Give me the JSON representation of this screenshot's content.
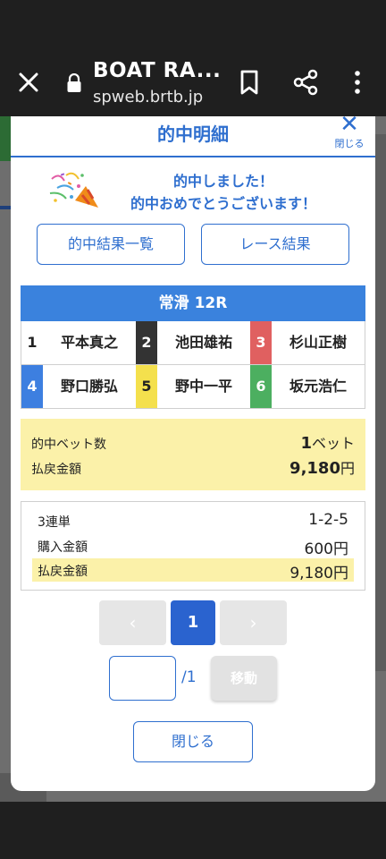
{
  "browser": {
    "title": "BOAT RA...",
    "url": "spweb.brtb.jp"
  },
  "modal": {
    "title": "的中明細",
    "close_label": "閉じる",
    "congrats_line1": "的中しました！",
    "congrats_line2": "的中おめでとうございます！",
    "hit_list_button": "的中結果一覧",
    "race_result_button": "レース結果",
    "race_header": "常滑 12R",
    "racers": [
      {
        "num": "1",
        "name": "平本真之",
        "color": "#ffffff",
        "text": "#222222"
      },
      {
        "num": "2",
        "name": "池田雄祐",
        "color": "#333333",
        "text": "#ffffff"
      },
      {
        "num": "3",
        "name": "杉山正樹",
        "color": "#e06060",
        "text": "#ffffff"
      },
      {
        "num": "4",
        "name": "野口勝弘",
        "color": "#3d7fe0",
        "text": "#ffffff"
      },
      {
        "num": "5",
        "name": "野中一平",
        "color": "#f4e04d",
        "text": "#222222"
      },
      {
        "num": "6",
        "name": "坂元浩仁",
        "color": "#4caf60",
        "text": "#ffffff"
      }
    ],
    "summary": {
      "bet_label": "的中ベット数",
      "bet_value_num": "1",
      "bet_value_unit": "ベット",
      "payout_label": "払戻金額",
      "payout_value": "9,180",
      "payout_unit": "円"
    },
    "detail": {
      "type_label": "3連単",
      "type_value": "1-2-5",
      "purchase_label": "購入金額",
      "purchase_value": "600円",
      "payout_label": "払戻金額",
      "payout_value": "9,180円"
    },
    "pager": {
      "prev": "‹",
      "current": "1",
      "next": "›"
    },
    "jump": {
      "input_value": "",
      "total": "/1",
      "go_label": "移動"
    },
    "close_button": "閉じる"
  }
}
